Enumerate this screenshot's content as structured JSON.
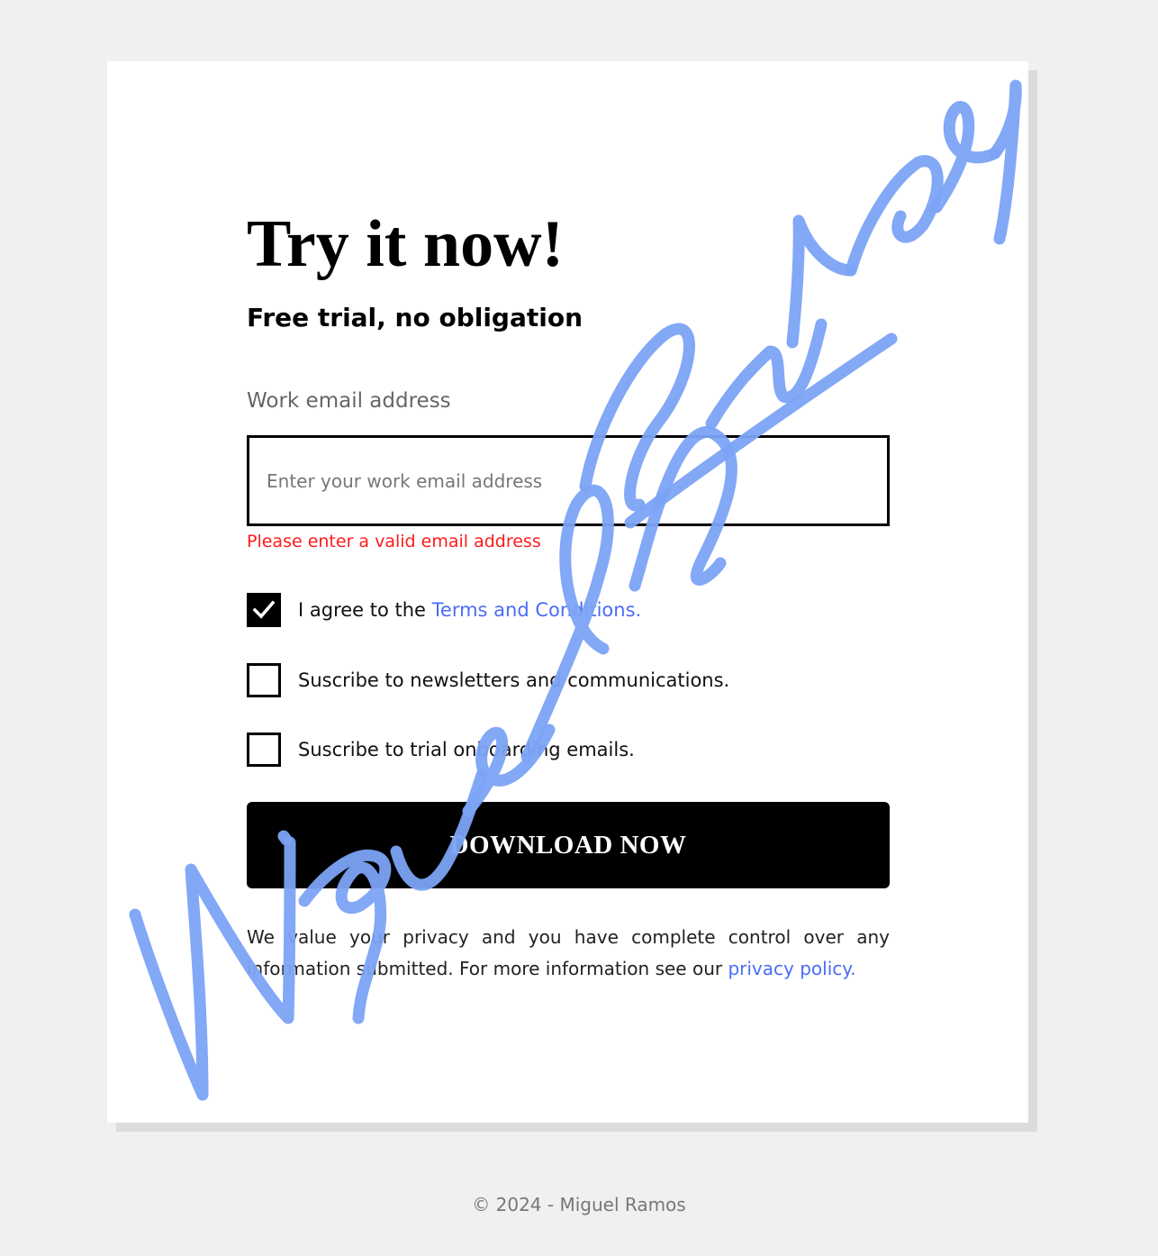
{
  "form": {
    "title": "Try it now!",
    "subtitle": "Free trial, no obligation",
    "email_label": "Work email address",
    "email_value": "",
    "email_placeholder": "Enter your work email address",
    "email_error": "Please enter a valid email address",
    "checkboxes": [
      {
        "text": "I agree to the ",
        "link_text": "Terms and Conditions.",
        "checked": true
      },
      {
        "text": "Suscribe to newsletters and communications.",
        "checked": false
      },
      {
        "text": "Suscribe to trial onboarding emails.",
        "checked": false
      }
    ],
    "submit_label": "DOWNLOAD NOW",
    "privacy_text": "We value your privacy and you have complete control over any information submitted. For more information see our ",
    "privacy_link": "privacy policy."
  },
  "footer": {
    "text": "© 2024 - Miguel Ramos"
  },
  "signature": {
    "text": "Miguel Ramos",
    "color": "#7ba3f5"
  },
  "colors": {
    "page_background": "#f0f0f0",
    "card_background": "#ffffff",
    "link": "#4a6cf7",
    "error": "#ff1a1a",
    "button_background": "#000000"
  }
}
